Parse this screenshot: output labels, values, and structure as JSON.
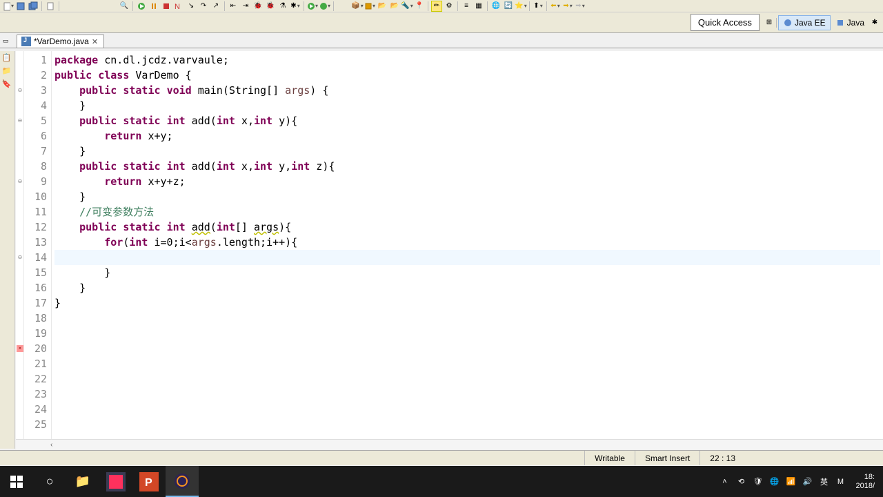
{
  "toolbar": {
    "quick_access": "Quick Access",
    "perspective_java_ee": "Java EE",
    "perspective_java": "Java"
  },
  "tab": {
    "title": "*VarDemo.java"
  },
  "code": {
    "lines": [
      {
        "n": 1,
        "marker": "",
        "tokens": [
          [
            "kw",
            "package"
          ],
          [
            "ident",
            " cn.dl.jcdz.varvaule;"
          ]
        ]
      },
      {
        "n": 2,
        "marker": "",
        "tokens": [
          [
            "",
            ""
          ]
        ]
      },
      {
        "n": 3,
        "marker": "fold",
        "tokens": [
          [
            "kw",
            "public"
          ],
          [
            "",
            " "
          ],
          [
            "kw",
            "class"
          ],
          [
            "ident",
            " VarDemo {"
          ]
        ]
      },
      {
        "n": 4,
        "marker": "",
        "tokens": [
          [
            "",
            ""
          ]
        ]
      },
      {
        "n": 5,
        "marker": "fold",
        "tokens": [
          [
            "",
            "    "
          ],
          [
            "kw",
            "public"
          ],
          [
            "",
            " "
          ],
          [
            "kw",
            "static"
          ],
          [
            "",
            " "
          ],
          [
            "kw",
            "void"
          ],
          [
            "ident",
            " main(String[] "
          ],
          [
            "param",
            "args"
          ],
          [
            "ident",
            ") {"
          ]
        ]
      },
      {
        "n": 6,
        "marker": "",
        "tokens": [
          [
            "",
            ""
          ]
        ]
      },
      {
        "n": 7,
        "marker": "",
        "tokens": [
          [
            "ident",
            "    }"
          ]
        ]
      },
      {
        "n": 8,
        "marker": "",
        "tokens": [
          [
            "",
            ""
          ]
        ]
      },
      {
        "n": 9,
        "marker": "fold",
        "tokens": [
          [
            "",
            "    "
          ],
          [
            "kw",
            "public"
          ],
          [
            "",
            " "
          ],
          [
            "kw",
            "static"
          ],
          [
            "",
            " "
          ],
          [
            "kw",
            "int"
          ],
          [
            "ident",
            " add("
          ],
          [
            "kw",
            "int"
          ],
          [
            "ident",
            " x,"
          ],
          [
            "kw",
            "int"
          ],
          [
            "ident",
            " y){"
          ]
        ]
      },
      {
        "n": 10,
        "marker": "",
        "tokens": [
          [
            "",
            ""
          ]
        ]
      },
      {
        "n": 11,
        "marker": "",
        "tokens": [
          [
            "",
            "        "
          ],
          [
            "kw",
            "return"
          ],
          [
            "ident",
            " x+y;"
          ]
        ]
      },
      {
        "n": 12,
        "marker": "",
        "tokens": [
          [
            "ident",
            "    }"
          ]
        ]
      },
      {
        "n": 13,
        "marker": "",
        "tokens": [
          [
            "",
            ""
          ]
        ]
      },
      {
        "n": 14,
        "marker": "fold",
        "tokens": [
          [
            "",
            "    "
          ],
          [
            "kw",
            "public"
          ],
          [
            "",
            " "
          ],
          [
            "kw",
            "static"
          ],
          [
            "",
            " "
          ],
          [
            "kw",
            "int"
          ],
          [
            "ident",
            " add("
          ],
          [
            "kw",
            "int"
          ],
          [
            "ident",
            " x,"
          ],
          [
            "kw",
            "int"
          ],
          [
            "ident",
            " y,"
          ],
          [
            "kw",
            "int"
          ],
          [
            "ident",
            " z){"
          ]
        ]
      },
      {
        "n": 15,
        "marker": "",
        "tokens": [
          [
            "",
            ""
          ]
        ]
      },
      {
        "n": 16,
        "marker": "",
        "tokens": [
          [
            "",
            "        "
          ],
          [
            "kw",
            "return"
          ],
          [
            "ident",
            " x+y+z;"
          ]
        ]
      },
      {
        "n": 17,
        "marker": "",
        "tokens": [
          [
            "ident",
            "    }"
          ]
        ]
      },
      {
        "n": 18,
        "marker": "",
        "tokens": [
          [
            "",
            ""
          ]
        ]
      },
      {
        "n": 19,
        "marker": "",
        "tokens": [
          [
            "",
            "    "
          ],
          [
            "cm",
            "//可变参数方法"
          ]
        ]
      },
      {
        "n": 20,
        "marker": "err",
        "tokens": [
          [
            "",
            "    "
          ],
          [
            "kw",
            "public"
          ],
          [
            "",
            " "
          ],
          [
            "kw",
            "static"
          ],
          [
            "",
            " "
          ],
          [
            "kw",
            "int"
          ],
          [
            "ident",
            " "
          ],
          [
            "squig",
            "add"
          ],
          [
            "ident",
            "("
          ],
          [
            "kw",
            "int"
          ],
          [
            "ident",
            "[] "
          ],
          [
            "squig",
            "args"
          ],
          [
            "ident",
            "){"
          ]
        ]
      },
      {
        "n": 21,
        "marker": "",
        "tokens": [
          [
            "",
            "        "
          ],
          [
            "kw",
            "for"
          ],
          [
            "ident",
            "("
          ],
          [
            "kw",
            "int"
          ],
          [
            "ident",
            " i=0;i<"
          ],
          [
            "param",
            "args"
          ],
          [
            "ident",
            ".length;i++){"
          ]
        ]
      },
      {
        "n": 22,
        "marker": "",
        "tokens": [
          [
            "",
            "            "
          ]
        ],
        "current": true
      },
      {
        "n": 23,
        "marker": "",
        "tokens": [
          [
            "ident",
            "        }"
          ]
        ]
      },
      {
        "n": 24,
        "marker": "",
        "tokens": [
          [
            "ident",
            "    }"
          ]
        ]
      },
      {
        "n": 25,
        "marker": "",
        "tokens": [
          [
            "ident",
            "}"
          ]
        ]
      }
    ]
  },
  "status": {
    "writable": "Writable",
    "insert_mode": "Smart Insert",
    "cursor_pos": "22 : 13"
  },
  "taskbar": {
    "ime": "英",
    "time": "18:",
    "date": "2018/"
  }
}
